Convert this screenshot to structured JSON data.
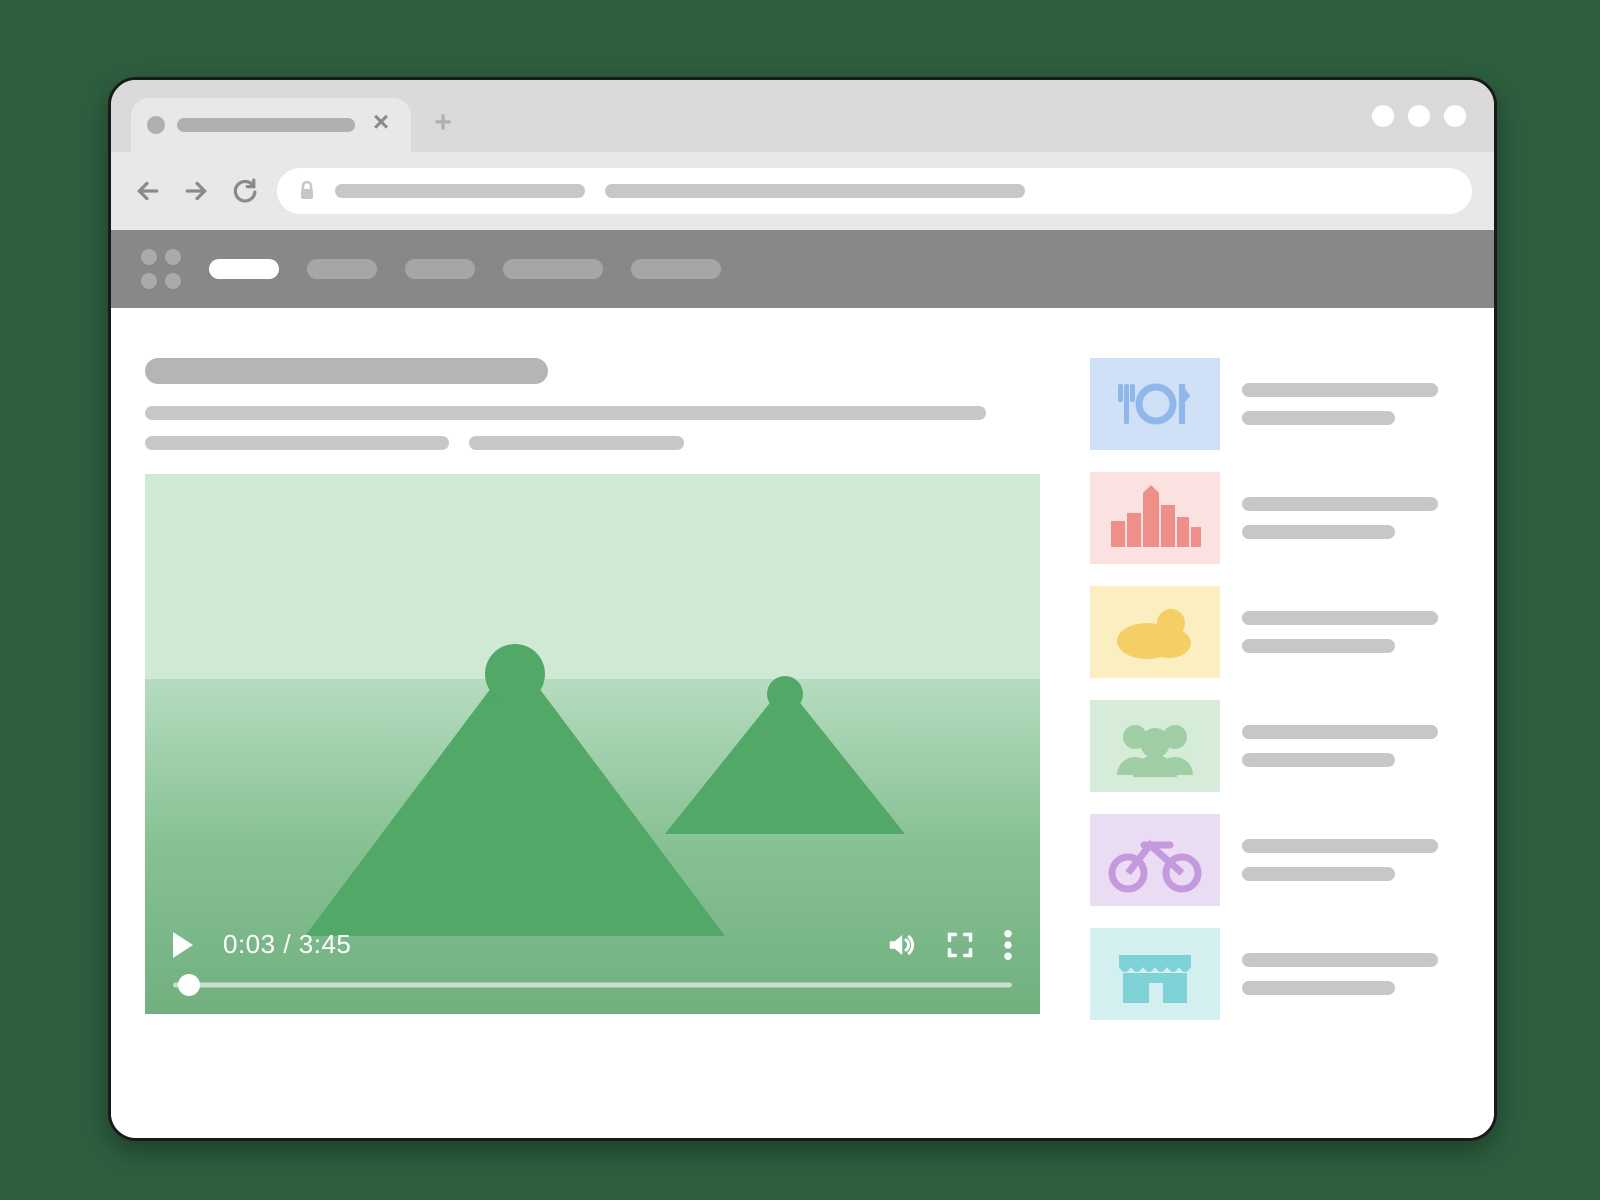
{
  "browser_tab": {
    "close_glyph": "×",
    "new_tab_glyph": "+"
  },
  "video": {
    "current_time": "0:03",
    "duration": "3:45",
    "separator": " / "
  },
  "sidebar": {
    "items": [
      {
        "icon": "dining-icon",
        "bg": "#cfe0f7",
        "fg": "#8fb7ea"
      },
      {
        "icon": "city-icon",
        "bg": "#fbe1df",
        "fg": "#ee9089"
      },
      {
        "icon": "weather-icon",
        "bg": "#fbeec0",
        "fg": "#f3cf66"
      },
      {
        "icon": "people-icon",
        "bg": "#d6ecd9",
        "fg": "#9fcea4"
      },
      {
        "icon": "bicycle-icon",
        "bg": "#eadcf3",
        "fg": "#c49adf"
      },
      {
        "icon": "storefront-icon",
        "bg": "#d3eff0",
        "fg": "#7fd2d6"
      }
    ]
  }
}
